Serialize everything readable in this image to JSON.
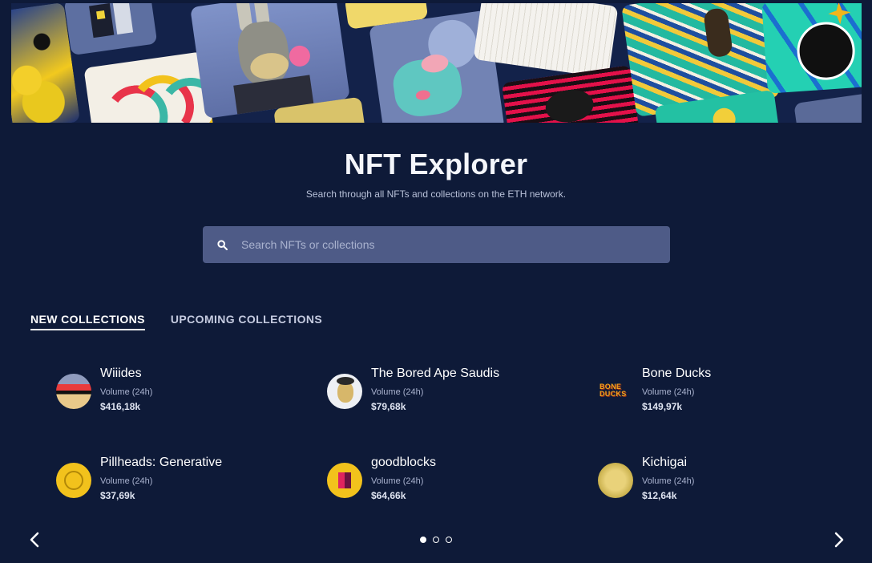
{
  "hero": {
    "title": "NFT Explorer",
    "subtitle": "Search through all NFTs and collections on the ETH network."
  },
  "search": {
    "placeholder": "Search NFTs or collections",
    "value": ""
  },
  "tabs": [
    {
      "label": "NEW COLLECTIONS",
      "active": true
    },
    {
      "label": "UPCOMING COLLECTIONS",
      "active": false
    }
  ],
  "collections": [
    {
      "name": "Wiiides",
      "label": "Volume (24h)",
      "value": "$416,18k"
    },
    {
      "name": "The Bored Ape Saudis",
      "label": "Volume (24h)",
      "value": "$79,68k"
    },
    {
      "name": "Bone Ducks",
      "label": "Volume (24h)",
      "value": "$149,97k",
      "logo_text": "BONE DUCKS"
    },
    {
      "name": "Pillheads: Generative",
      "label": "Volume (24h)",
      "value": "$37,69k"
    },
    {
      "name": "goodblocks",
      "label": "Volume (24h)",
      "value": "$64,66k"
    },
    {
      "name": "Kichigai",
      "label": "Volume (24h)",
      "value": "$12,64k"
    }
  ],
  "pager": {
    "pages": 3,
    "current": 1
  },
  "icons": {
    "search": "search-icon",
    "prev": "chevron-left-icon",
    "next": "chevron-right-icon"
  },
  "colors": {
    "background": "#0e1a38",
    "search_box": "#4e5b87",
    "text_primary": "#ffffff",
    "text_muted": "#aab3cf"
  }
}
